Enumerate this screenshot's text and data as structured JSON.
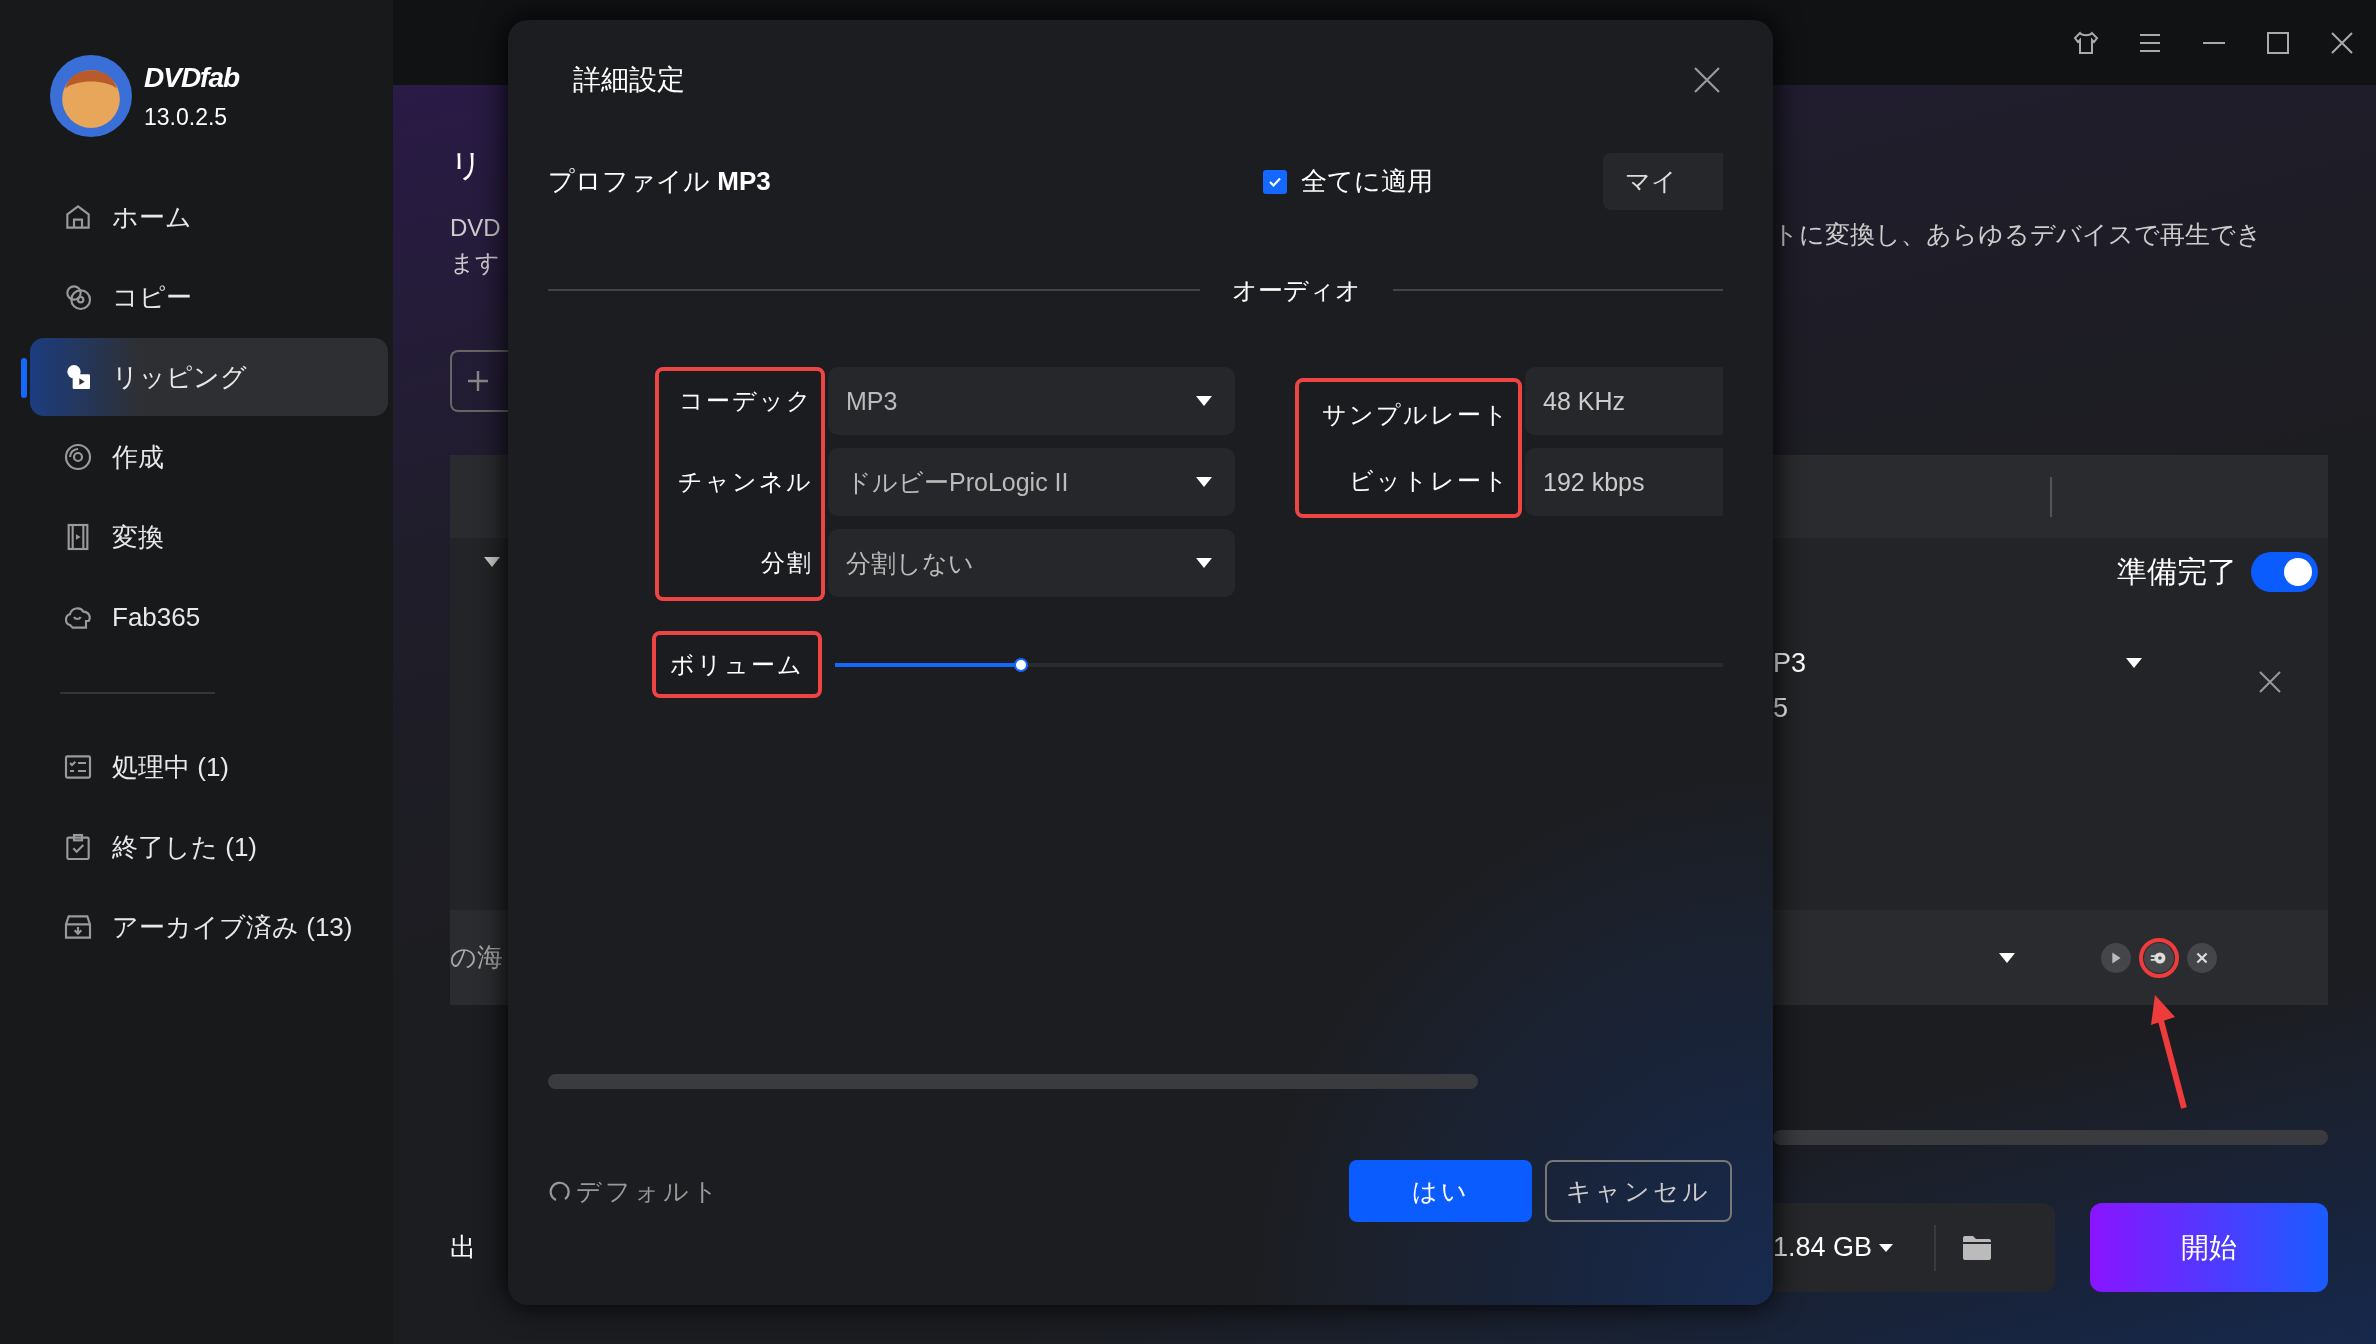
{
  "app": {
    "logo_text": "DVDfab",
    "version": "13.0.2.5"
  },
  "sidebar": {
    "items": [
      {
        "label": "ホーム",
        "selected": false
      },
      {
        "label": "コピー",
        "selected": false
      },
      {
        "label": "リッピング",
        "selected": true
      },
      {
        "label": "作成",
        "selected": false
      },
      {
        "label": "変換",
        "selected": false
      },
      {
        "label": "Fab365",
        "selected": false
      }
    ],
    "queue": [
      {
        "label": "処理中 (1)"
      },
      {
        "label": "終了した (1)"
      },
      {
        "label": "アーカイブ済み (13)"
      }
    ]
  },
  "background": {
    "left": {
      "heading": "リ",
      "desc_lines": [
        "DVD",
        "ます"
      ],
      "row_title": "の海",
      "output_label": "出"
    },
    "right": {
      "desc": "トに変換し、あらゆるデバイスで再生でき",
      "ready_label": "準備完了",
      "ready_on": true,
      "format": "P3",
      "format_line_2": "5",
      "file_size": "1.84 GB",
      "start_button": "開始",
      "row_actions": [
        {
          "highlighted": false
        },
        {
          "highlighted": true
        },
        {
          "highlighted": false
        }
      ],
      "annotation_arrow": true
    }
  },
  "dialog": {
    "title": "詳細設定",
    "profile": "プロファイル **MP3**",
    "apply_all": {
      "label": "全てに適用",
      "checked": true
    },
    "my_profile_button": "マイ",
    "section": "オーディオ",
    "left_fields": {
      "highlighted": true,
      "items": [
        {
          "label": "コーデック",
          "value": "MP3"
        },
        {
          "label": "チャンネル",
          "value": "ドルビーProLogic II"
        },
        {
          "label": "分割",
          "value": "分割しない"
        }
      ]
    },
    "right_fields": {
      "highlighted": true,
      "items": [
        {
          "label": "サンプルレート",
          "value": "48 KHz"
        },
        {
          "label": "ビットレート",
          "value": "192 kbps"
        }
      ]
    },
    "volume": {
      "label": "ボリューム",
      "highlighted": true,
      "level": 0.21
    },
    "default_link": "デフォルト",
    "ok_button": "はい",
    "cancel_button": "キャンセル"
  }
}
